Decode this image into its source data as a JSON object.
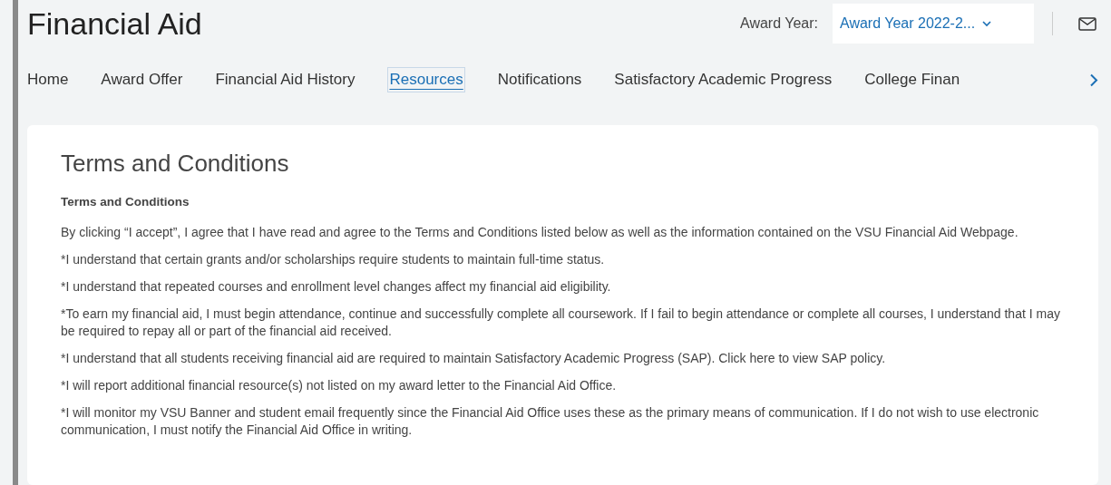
{
  "header": {
    "title": "Financial Aid",
    "award_year_label": "Award Year:",
    "award_year_value": "Award Year 2022-2..."
  },
  "tabs": [
    {
      "label": "Home",
      "selected": false
    },
    {
      "label": "Award Offer",
      "selected": false
    },
    {
      "label": "Financial Aid History",
      "selected": false
    },
    {
      "label": "Resources",
      "selected": true
    },
    {
      "label": "Notifications",
      "selected": false
    },
    {
      "label": "Satisfactory Academic Progress",
      "selected": false
    },
    {
      "label": "College Finan",
      "selected": false
    }
  ],
  "card": {
    "heading": "Terms and Conditions",
    "subheading": "Terms and Conditions",
    "paragraphs": [
      "By clicking “I accept”, I agree that I have read and agree to the Terms and Conditions listed below as well as the information contained on the VSU Financial Aid Webpage.",
      "*I understand that certain grants and/or scholarships require students to maintain full-time status.",
      "*I understand that repeated courses and enrollment level changes affect my financial aid eligibility.",
      "*To earn my financial aid, I must begin attendance, continue and successfully complete all coursework. If I fail to begin attendance or complete all courses, I understand that I may be required to repay all or part of the financial aid received.",
      "*I understand that all students receiving financial aid are required to maintain Satisfactory Academic Progress (SAP). Click here to view SAP policy.",
      "*I will report additional financial resource(s) not listed on my award letter to the Financial Aid Office.",
      "*I will monitor my VSU Banner and student email frequently since the Financial Aid Office uses these as the primary means of communication. If I do not wish to use electronic communication, I must notify the Financial Aid Office in writing."
    ]
  }
}
